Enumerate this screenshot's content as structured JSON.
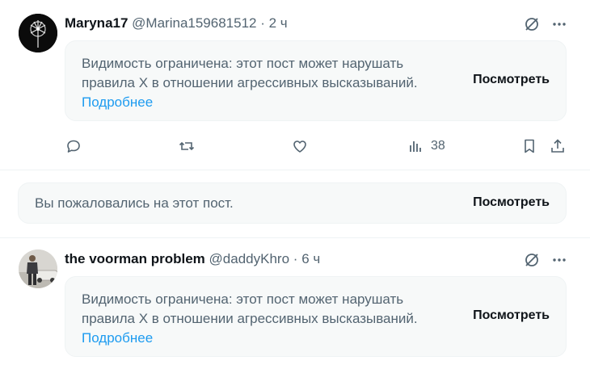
{
  "posts": [
    {
      "display_name": "Maryna17",
      "handle": "@Marina159681512",
      "separator": "·",
      "time": "2 ч",
      "notice_text": "Видимость ограничена: этот пост может нарушать правила X в отношении агрессивных высказываний.",
      "more_link": "Подробнее",
      "view_label": "Посмотреть",
      "stats": {
        "views": "38"
      }
    },
    {
      "display_name": "the voorman problem",
      "handle": "@daddyKhro",
      "separator": "·",
      "time": "6 ч",
      "notice_text": "Видимость ограничена: этот пост может нарушать правила X в отношении агрессивных высказываний.",
      "more_link": "Подробнее",
      "view_label": "Посмотреть"
    }
  ],
  "reported": {
    "text": "Вы пожаловались на этот пост.",
    "view_label": "Посмотреть"
  },
  "icons": {
    "hidden": "eye-slash-icon",
    "more": "more-icon",
    "reply": "reply-icon",
    "repost": "repost-icon",
    "like": "like-icon",
    "views": "views-icon",
    "bookmark": "bookmark-icon",
    "share": "share-icon"
  },
  "colors": {
    "text_primary": "#0f1419",
    "text_secondary": "#536471",
    "link": "#1d9bf0",
    "notice_bg": "#f7f9f9",
    "divider": "#eff3f4"
  }
}
